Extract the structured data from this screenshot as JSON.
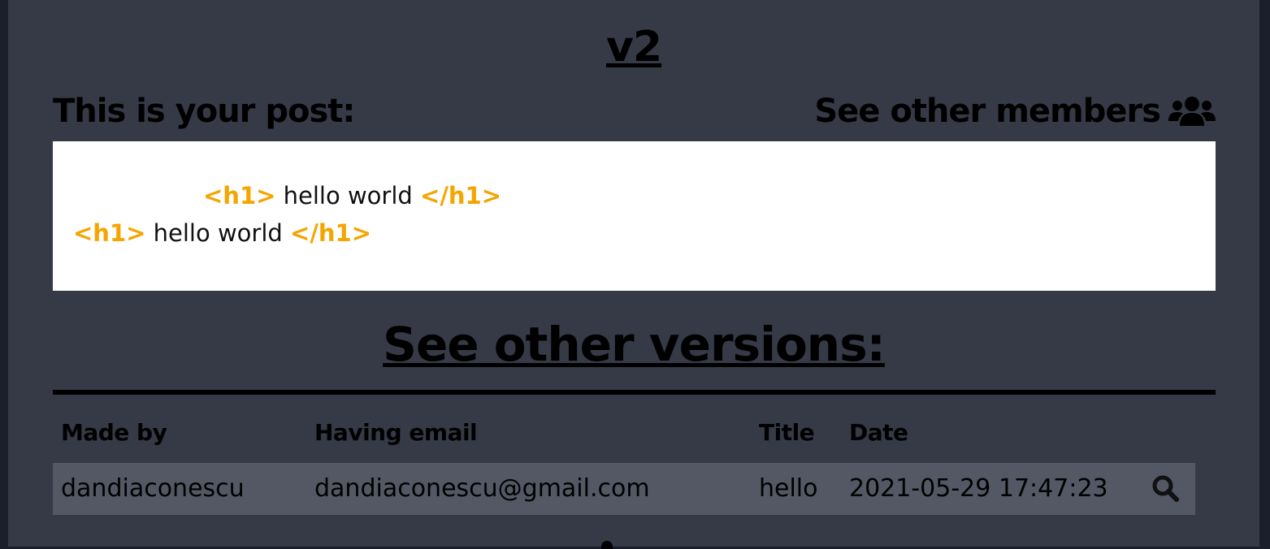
{
  "page": {
    "version_title": "v2",
    "post_heading": "This is your post:",
    "members_link": "See other members",
    "members_icon": "users-icon"
  },
  "post": {
    "lines": [
      {
        "open_tag": "<h1>",
        "text": "hello world",
        "close_tag": "</h1>"
      },
      {
        "open_tag": "<h1>",
        "text": "hello world",
        "close_tag": "</h1>"
      }
    ]
  },
  "versions": {
    "heading": "See other versions:",
    "columns": [
      "Made by",
      "Having email",
      "Title",
      "Date"
    ],
    "rows": [
      {
        "made_by": "dandiaconescu",
        "email": "dandiaconescu@gmail.com",
        "title": "hello",
        "date": "2021-05-29 17:47:23",
        "action_icon": "search-icon"
      }
    ]
  },
  "colors": {
    "page_background": "#363a47",
    "outer_background": "#1b1f2b",
    "tag_color": "#f5a500",
    "row_background": "#535864"
  }
}
